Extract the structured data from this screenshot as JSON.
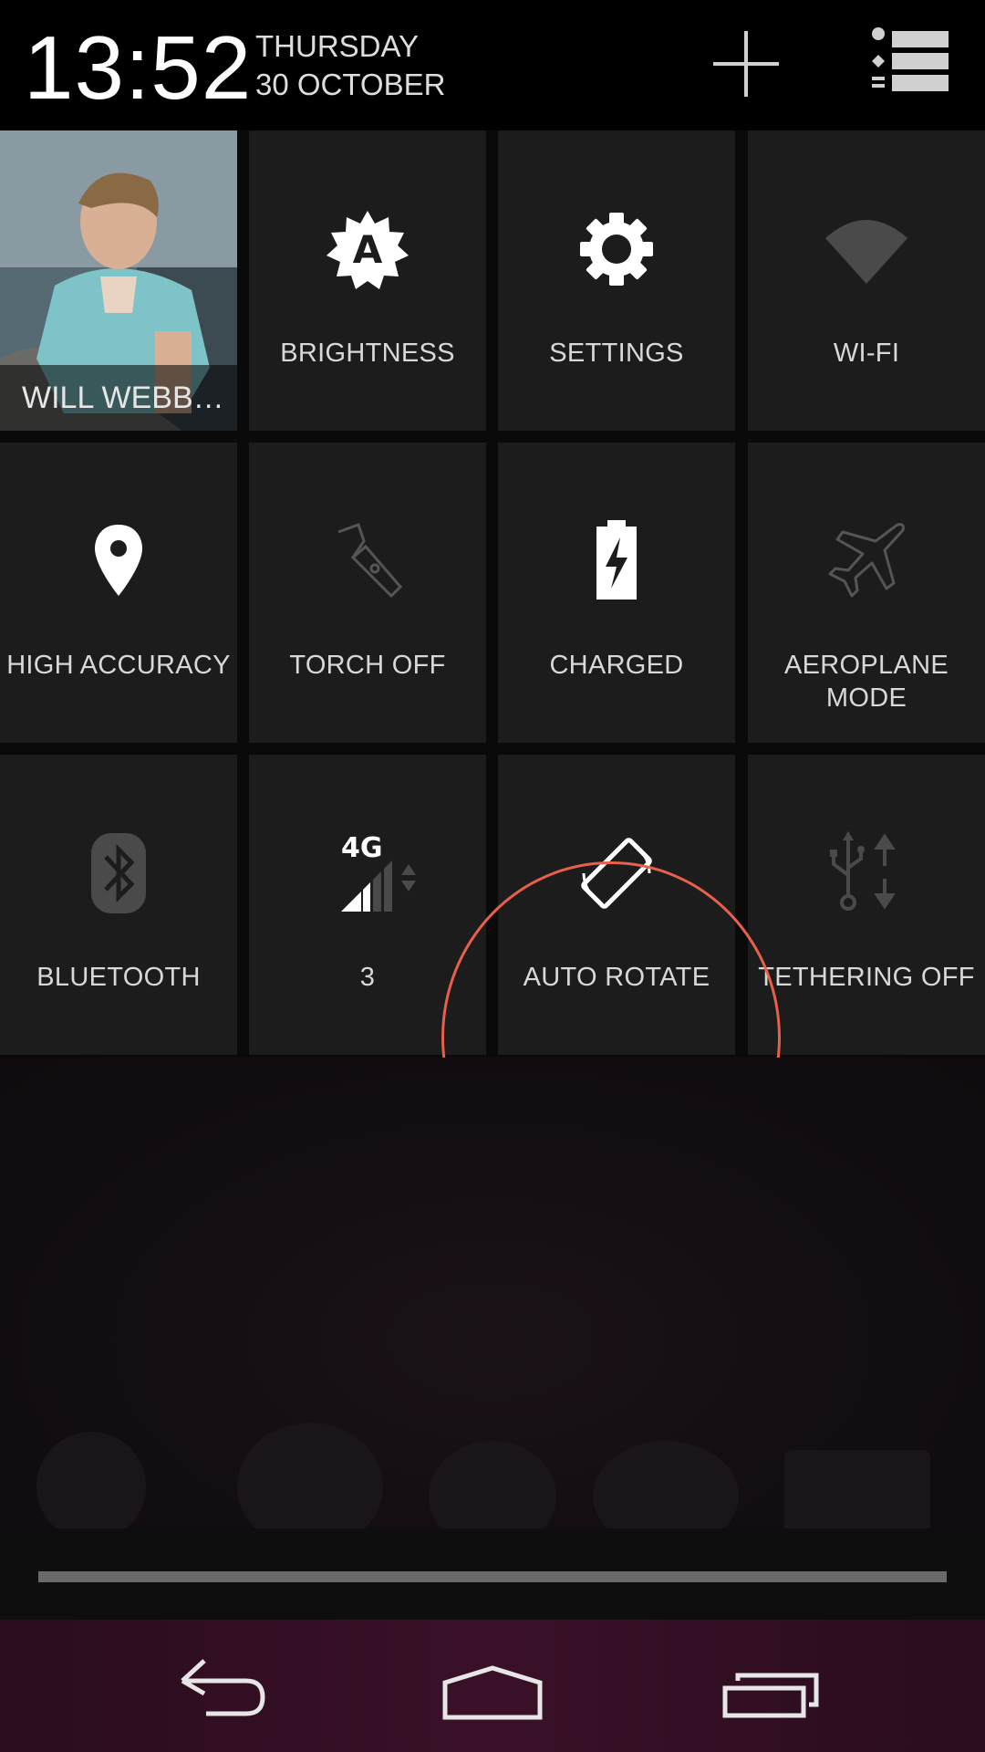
{
  "status": {
    "time": "13:52",
    "day": "THURSDAY",
    "date": "30 OCTOBER"
  },
  "header_icons": {
    "add": "plus-icon",
    "notifications": "list-icon"
  },
  "tiles": {
    "user": {
      "label": "WILL WEBB…",
      "icon": "user-photo"
    },
    "brightness": {
      "label": "BRIGHTNESS",
      "icon": "auto-brightness-icon"
    },
    "settings": {
      "label": "SETTINGS",
      "icon": "gear-icon"
    },
    "wifi": {
      "label": "WI-FI",
      "icon": "wifi-icon"
    },
    "location": {
      "label": "HIGH ACCURACY",
      "icon": "location-pin-icon"
    },
    "torch": {
      "label": "TORCH OFF",
      "icon": "torch-icon"
    },
    "battery": {
      "label": "CHARGED",
      "icon": "battery-charging-icon"
    },
    "airplane": {
      "label_line1": "AEROPLANE",
      "label_line2": "MODE",
      "icon": "airplane-icon"
    },
    "bluetooth": {
      "label": "BLUETOOTH",
      "icon": "bluetooth-icon"
    },
    "mobile_data": {
      "label": "3",
      "badge": "4G",
      "icon": "cell-signal-icon"
    },
    "rotate": {
      "label": "AUTO ROTATE",
      "icon": "auto-rotate-icon"
    },
    "tethering": {
      "label": "TETHERING OFF",
      "icon": "usb-tether-icon"
    }
  },
  "colors": {
    "highlight_ring": "#e8604c",
    "tile_bg": "#1c1c1c",
    "active_icon": "#ffffff",
    "inactive_icon": "#555555"
  },
  "navigation": {
    "back": "back-icon",
    "home": "home-icon",
    "recents": "recents-icon"
  }
}
